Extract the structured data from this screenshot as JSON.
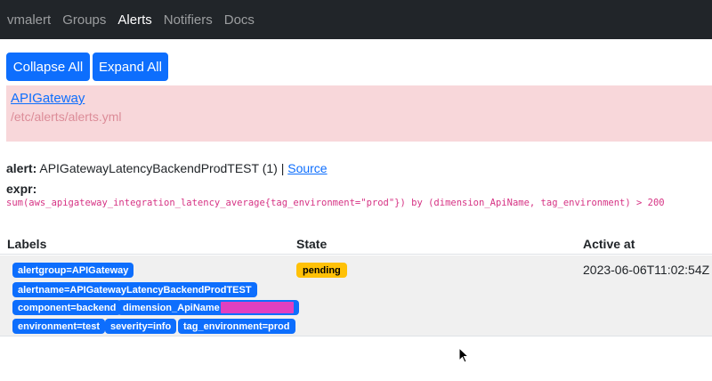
{
  "nav": {
    "brand": "vmalert",
    "items": [
      "Groups",
      "Alerts",
      "Notifiers",
      "Docs"
    ],
    "active": "Alerts"
  },
  "toolbar": {
    "collapse_label": "Collapse All",
    "expand_label": "Expand All"
  },
  "group": {
    "name": "APIGateway",
    "file": "/etc/alerts/alerts.yml"
  },
  "alert": {
    "label": "alert:",
    "name": "APIGatewayLatencyBackendProdTEST",
    "count": "(1)",
    "separator": "|",
    "source_link": "Source",
    "expr_label": "expr:",
    "expr": "sum(aws_apigateway_integration_latency_average{tag_environment=\"prod\"}) by (dimension_ApiName, tag_environment) > 200"
  },
  "table": {
    "headers": [
      "Labels",
      "State",
      "Active at"
    ],
    "row": {
      "labels": [
        "alertgroup=APIGateway",
        "alertname=APIGatewayLatencyBackendProdTEST",
        "component=backend",
        "dimension_ApiName",
        "environment=test",
        "severity=info",
        "tag_environment=prod"
      ],
      "state": "pending",
      "active_at": "2023-06-06T11:02:54Z"
    }
  },
  "colors": {
    "navbar": "#212529",
    "primary": "#0d6efd",
    "group_bg": "#f8d7da",
    "expr": "#d63384",
    "pending": "#ffc107",
    "redaction": "#e040c0"
  }
}
